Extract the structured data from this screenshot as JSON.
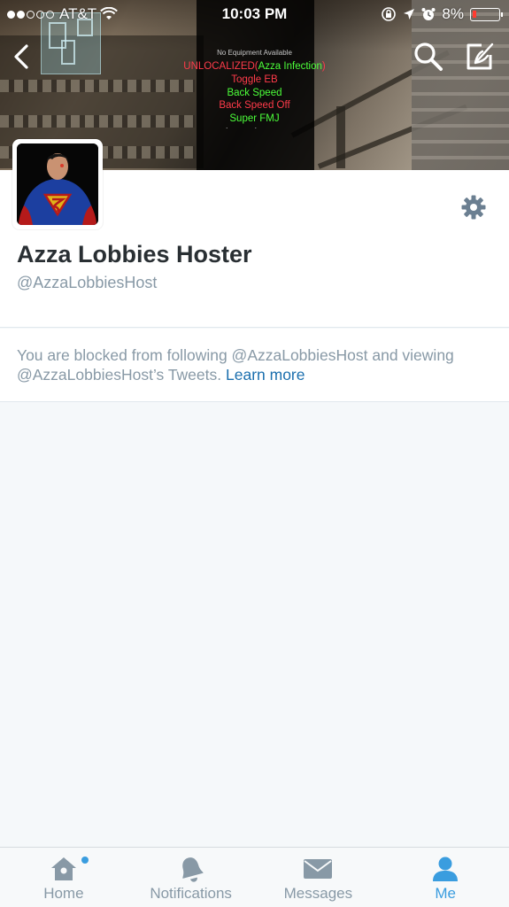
{
  "status_bar": {
    "carrier": "AT&T",
    "time": "10:03 PM",
    "battery_percent": "8%"
  },
  "banner": {
    "mod_menu": {
      "subtitle": "No Equipment Available",
      "line1_prefix": "UNLOCALIZED(",
      "line1_highlight": "Azza Infection",
      "line1_suffix": ")",
      "items": [
        "Toggle EB",
        "Back Speed",
        "Back Speed Off",
        "Super FMJ"
      ],
      "item_colors": [
        "#ff3b4a",
        "#4cff3a",
        "#ff3b4a",
        "#4cff3a"
      ]
    }
  },
  "nav": {
    "back_icon": "chevron-left-icon",
    "search_icon": "search-icon",
    "compose_icon": "compose-icon"
  },
  "profile": {
    "name": "Azza Lobbies Hoster",
    "handle": "@AzzaLobbiesHost",
    "settings_icon": "gear-icon"
  },
  "blocked": {
    "message": "You are blocked from following @AzzaLobbiesHost and viewing @AzzaLobbiesHost’s Tweets. ",
    "link": "Learn more"
  },
  "tabbar": {
    "tabs": [
      {
        "label": "Home",
        "icon": "home-icon"
      },
      {
        "label": "Notifications",
        "icon": "bell-icon"
      },
      {
        "label": "Messages",
        "icon": "envelope-icon"
      },
      {
        "label": "Me",
        "icon": "person-icon"
      }
    ],
    "active": "Me"
  },
  "colors": {
    "accent": "#3a9ddf",
    "link": "#1b6fae",
    "muted": "#8899a6",
    "text": "#292f33",
    "background": "#f5f8fa"
  }
}
